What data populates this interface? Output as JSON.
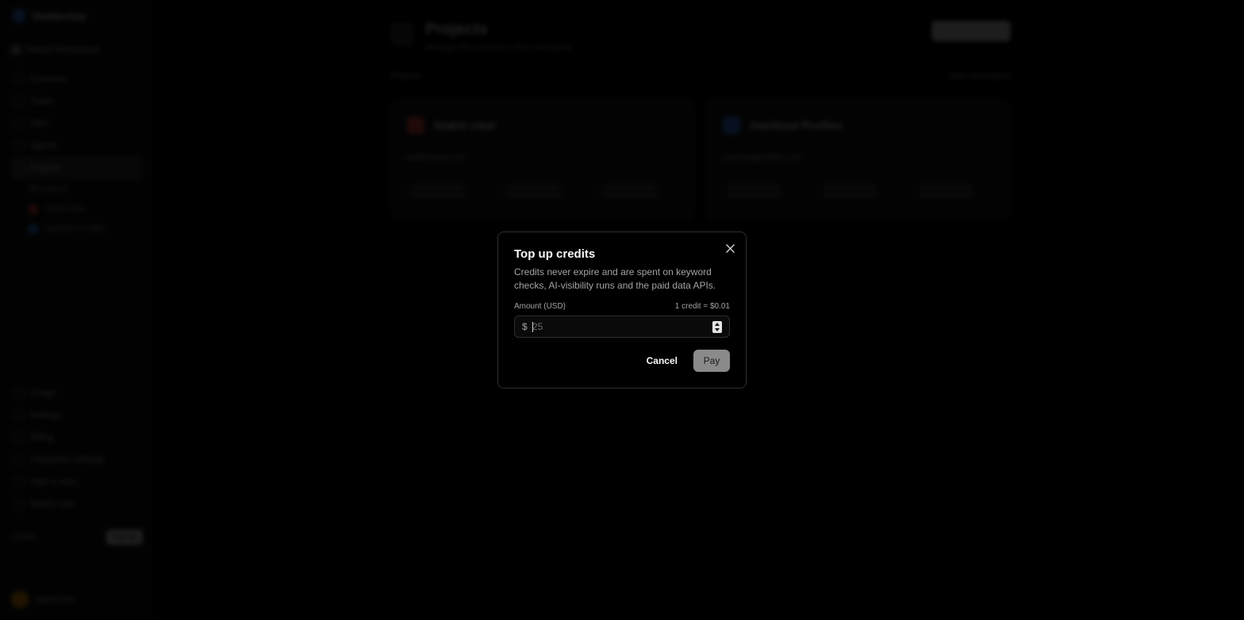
{
  "background": {
    "sidebar": {
      "brand": "Stableclear",
      "workspace": "Default Workspace",
      "nav": [
        "Overview",
        "Tasks",
        "Sites",
        "Agents",
        "Projects"
      ],
      "projects_label": "All projects",
      "projects": [
        {
          "label": "Stable clear",
          "color": "#ef4444"
        },
        {
          "label": "Sanitized Profiles",
          "color": "#3b82f6"
        }
      ],
      "bottom_nav": [
        "Usage",
        "Settings",
        "Billing",
        "Integration settings",
        "Help & docs",
        "What's new"
      ],
      "credits_label": "Credits",
      "top_up": "Top up",
      "plan": "Upgrade",
      "user": "Stableclear"
    },
    "page": {
      "title": "Projects",
      "subtitle": "Manage the projects in this workspace",
      "section": "Projects",
      "section_action": "View all projects",
      "cards": [
        {
          "name": "Stable clear",
          "domain": "stableclear.com",
          "color": "#ef4444"
        },
        {
          "name": "Sanitized Profiles",
          "domain": "sanitizedprofiles.com",
          "color": "#3b82f6"
        }
      ]
    }
  },
  "modal": {
    "title": "Top up credits",
    "description": "Credits never expire and are spent on keyword checks, AI-visibility runs and the paid data APIs.",
    "amount_label": "Amount (USD)",
    "rate": "1 credit = $0.01",
    "currency_symbol": "$",
    "amount_placeholder": "25",
    "amount_value": "",
    "cancel_label": "Cancel",
    "pay_label": "Pay"
  }
}
